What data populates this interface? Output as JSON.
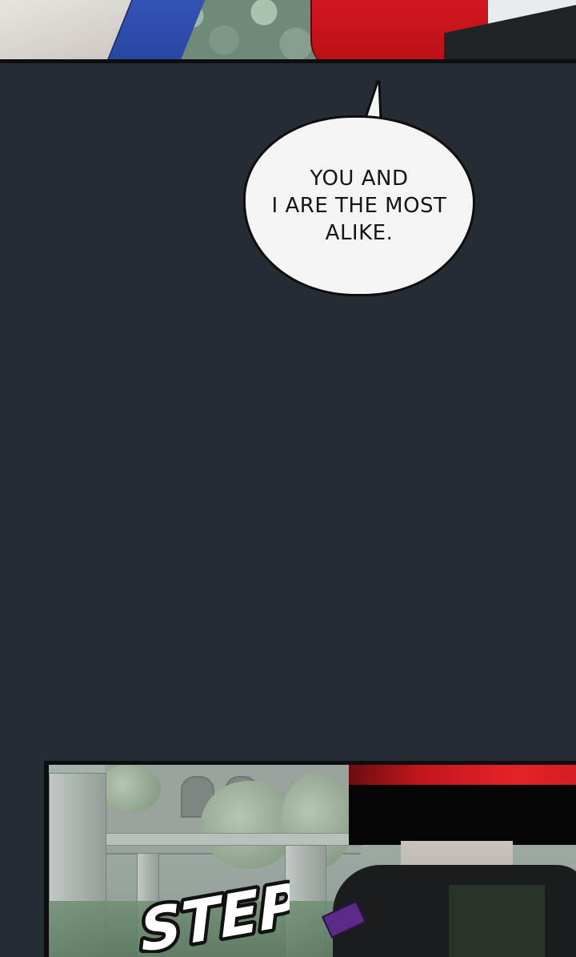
{
  "panels": {
    "top": {
      "description_colors": {
        "white_cloth": "#e6e2dd",
        "blue_cloth": "#2f4fb0",
        "red_cloth": "#c8131b",
        "foliage": "#7d9986"
      }
    },
    "middle": {
      "background": "#262c33",
      "speech_bubble": {
        "lines": [
          "YOU AND",
          "I ARE THE MOST",
          "ALIKE."
        ]
      }
    },
    "bottom": {
      "sound_effect": "STEP",
      "sfx_fill": "#ffffff",
      "sfx_stroke": "#111111"
    }
  }
}
